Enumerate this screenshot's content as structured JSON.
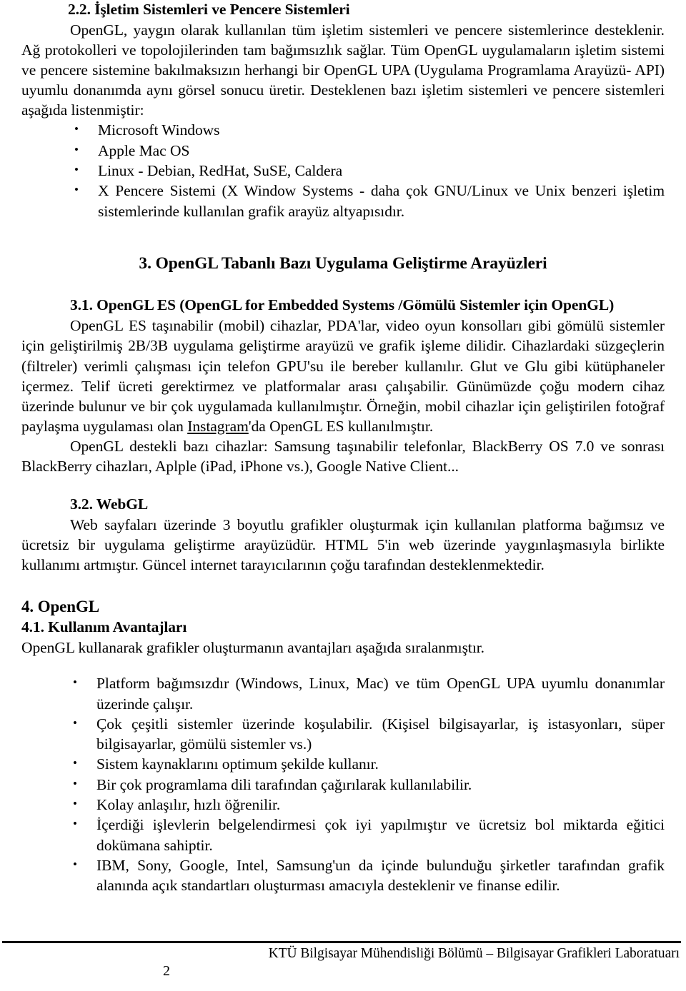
{
  "document": {
    "section_2_2": {
      "heading": "2.2. İşletim Sistemleri ve  Pencere Sistemleri",
      "paragraph": "OpenGL, yaygın olarak kullanılan tüm işletim sistemleri ve pencere sistemlerince desteklenir. Ağ protokolleri ve topolojilerinden tam bağımsızlık sağlar. Tüm OpenGL uygulamaların işletim sistemi ve pencere sistemine bakılmaksızın herhangi bir OpenGL UPA (Uygulama Programlama Arayüzü- API) uyumlu donanımda aynı görsel sonucu üretir. Desteklenen bazı işletim sistemleri ve pencere sistemleri aşağıda listenmiştir:",
      "bullets": [
        "Microsoft Windows",
        "Apple Mac OS",
        "Linux - Debian, RedHat, SuSE, Caldera",
        "X Pencere Sistemi (X Window Systems - daha çok GNU/Linux ve Unix benzeri işletim sistemlerinde kullanılan grafik arayüz altyapısıdır."
      ]
    },
    "section_3": {
      "heading": "3. OpenGL Tabanlı Bazı Uygulama Geliştirme Arayüzleri"
    },
    "section_3_1": {
      "heading": "3.1. OpenGL ES (OpenGL for Embedded Systems /Gömülü Sistemler için OpenGL)",
      "paragraph_1_before_link": "OpenGL ES taşınabilir (mobil) cihazlar, PDA'lar, video oyun konsolları gibi gömülü sistemler için geliştirilmiş 2B/3B uygulama geliştirme arayüzü ve grafik işleme dilidir. Cihazlardaki süzgeçlerin (filtreler) verimli çalışması için telefon GPU'su ile bereber kullanılır. Glut ve Glu gibi kütüphaneler içermez. Telif ücreti gerektirmez ve platformalar arası çalışabilir. Günümüzde çoğu modern cihaz üzerinde bulunur ve bir çok uygulamada kullanılmıştır. Örneğin, mobil cihazlar için geliştirilen  fotoğraf paylaşma uygulaması olan ",
      "paragraph_1_link": "Instagram",
      "paragraph_1_after_link": "'da OpenGL ES kullanılmıştır.",
      "paragraph_2": "OpenGL destekli bazı cihazlar: Samsung taşınabilir telefonlar, BlackBerry OS 7.0 ve sonrası BlackBerry cihazları, Aplple (iPad, iPhone vs.), Google Native Client..."
    },
    "section_3_2": {
      "heading": "3.2. WebGL",
      "paragraph": "Web sayfaları üzerinde 3 boyutlu grafikler oluşturmak için kullanılan platforma bağımsız ve ücretsiz bir uygulama geliştirme arayüzüdür. HTML 5'in web üzerinde yaygınlaşmasıyla birlikte kullanımı artmıştır. Güncel internet tarayıcılarının çoğu  tarafından desteklenmektedir."
    },
    "section_4": {
      "heading": "4. OpenGL"
    },
    "section_4_1": {
      "heading": "4.1. Kullanım Avantajları",
      "paragraph": "OpenGL kullanarak grafikler oluşturmanın avantajları aşağıda sıralanmıştır.",
      "bullets": [
        "Platform bağımsızdır (Windows, Linux, Mac) ve tüm OpenGL UPA uyumlu donanımlar üzerinde çalışır.",
        "Çok çeşitli sistemler üzerinde koşulabilir. (Kişisel bilgisayarlar, iş istasyonları, süper bilgisayarlar, gömülü sistemler vs.)",
        "Sistem kaynaklarını optimum şekilde kullanır.",
        "Bir çok programlama dili tarafından çağırılarak kullanılabilir.",
        "Kolay anlaşılır, hızlı öğrenilir.",
        "İçerdiği işlevlerin belgelendirmesi çok iyi yapılmıştır ve ücretsiz  bol miktarda eğitici dokümana sahiptir.",
        "IBM, Sony, Google, Intel, Samsung'un da içinde bulunduğu şirketler tarafından grafik alanında açık standartları  oluşturması amacıyla desteklenir ve finanse edilir."
      ]
    },
    "footer": {
      "text": "KTÜ Bilgisayar Mühendisliği Bölümü – Bilgisayar Grafikleri Laboratuarı",
      "page_number": "2"
    }
  }
}
